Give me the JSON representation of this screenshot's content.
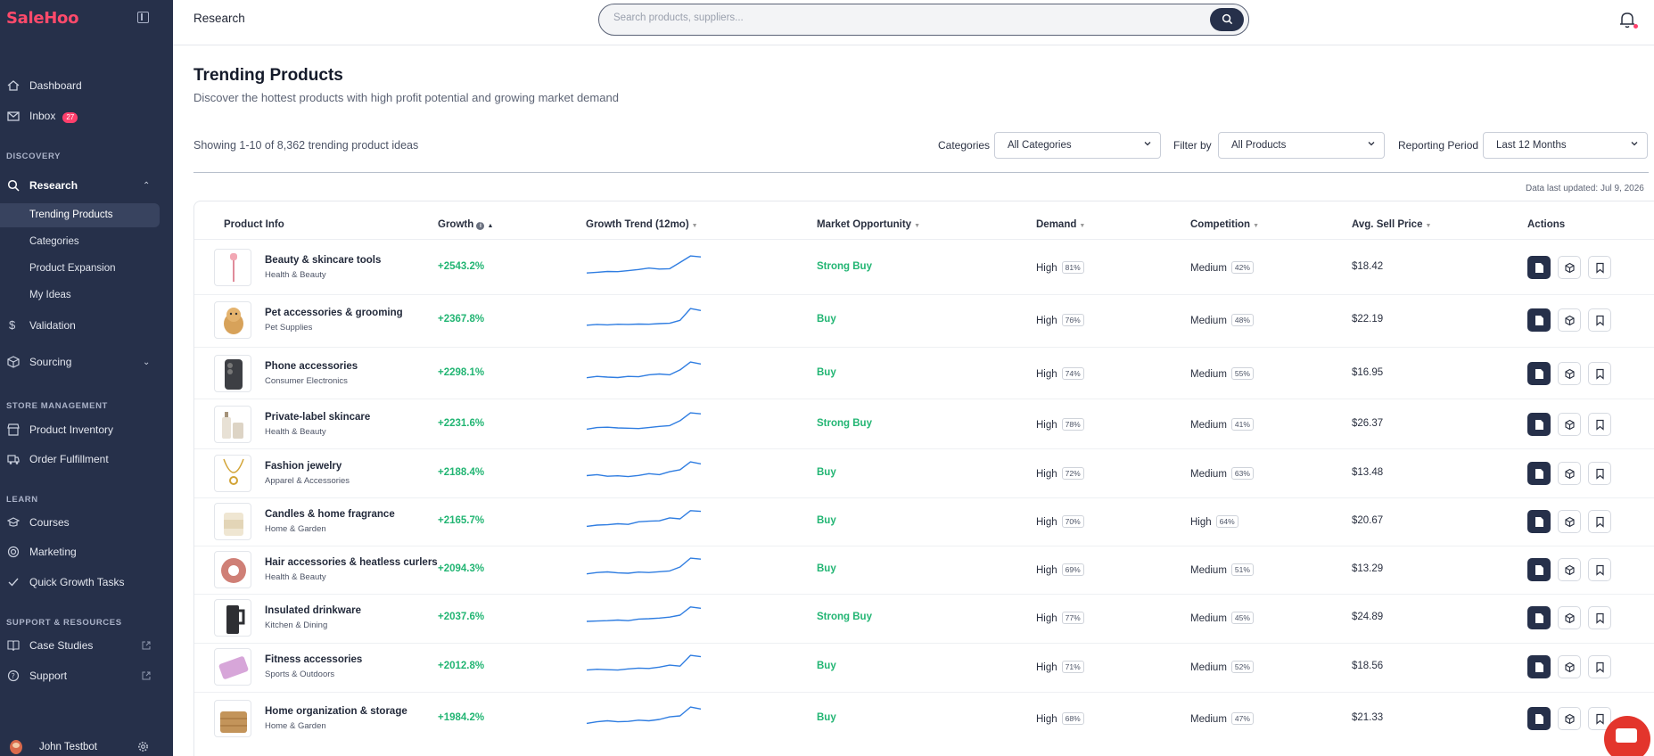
{
  "app": {
    "logo": "SaleHoo",
    "breadcrumb": "Research"
  },
  "search": {
    "placeholder": "Search products, suppliers..."
  },
  "sidebar": {
    "dashboard": "Dashboard",
    "inbox": "Inbox",
    "inbox_count": "27",
    "discovery": "DISCOVERY",
    "research": "Research",
    "research_sub": [
      "Trending Products",
      "Categories",
      "Product Expansion",
      "My Ideas"
    ],
    "validation": "Validation",
    "sourcing": "Sourcing",
    "store_management": "STORE MANAGEMENT",
    "product_inventory": "Product Inventory",
    "order_fulfillment": "Order Fulfillment",
    "learn": "LEARN",
    "courses": "Courses",
    "marketing": "Marketing",
    "quick_growth": "Quick Growth Tasks",
    "support_resources": "SUPPORT & RESOURCES",
    "case_studies": "Case Studies",
    "support": "Support",
    "user_name": "John Testbot"
  },
  "page": {
    "title": "Trending Products",
    "subtitle": "Discover the hottest products with high profit potential and growing market demand",
    "showing": "Showing 1-10 of 8,362 trending product ideas",
    "updated": "Data last updated: Jul 9, 2026"
  },
  "filters": {
    "categories_label": "Categories",
    "categories_value": "All Categories",
    "filter_label": "Filter by",
    "filter_value": "All Products",
    "period_label": "Reporting Period",
    "period_value": "Last 12 Months"
  },
  "columns": [
    "Product Info",
    "Growth",
    "Growth Trend (12mo)",
    "Market Opportunity",
    "Demand",
    "Competition",
    "Avg. Sell Price",
    "Actions"
  ],
  "rows": [
    {
      "name": "Beauty & skincare tools",
      "category": "Health & Beauty",
      "growth": "+2543.2%",
      "opportunity": "Strong Buy",
      "demand": "High",
      "demand_pct": "81%",
      "competition": "Medium",
      "competition_pct": "42%",
      "price": "$18.42",
      "thumb": "roller-icon",
      "trend": [
        0.08,
        0.12,
        0.16,
        0.15,
        0.2,
        0.26,
        0.33,
        0.28,
        0.3,
        0.62,
        0.95,
        0.9
      ]
    },
    {
      "name": "Pet accessories & grooming",
      "category": "Pet Supplies",
      "growth": "+2367.8%",
      "opportunity": "Buy",
      "demand": "High",
      "demand_pct": "76%",
      "competition": "Medium",
      "competition_pct": "48%",
      "price": "$22.19",
      "thumb": "dog-icon",
      "trend": [
        0.1,
        0.14,
        0.12,
        0.15,
        0.14,
        0.16,
        0.15,
        0.18,
        0.2,
        0.35,
        0.95,
        0.85
      ]
    },
    {
      "name": "Phone accessories",
      "category": "Consumer Electronics",
      "growth": "+2298.1%",
      "opportunity": "Buy",
      "demand": "High",
      "demand_pct": "74%",
      "competition": "Medium",
      "competition_pct": "55%",
      "price": "$16.95",
      "thumb": "phone-icon",
      "trend": [
        0.15,
        0.22,
        0.18,
        0.16,
        0.22,
        0.2,
        0.3,
        0.34,
        0.3,
        0.55,
        0.95,
        0.85
      ]
    },
    {
      "name": "Private-label skincare",
      "category": "Health & Beauty",
      "growth": "+2231.6%",
      "opportunity": "Strong Buy",
      "demand": "High",
      "demand_pct": "78%",
      "competition": "Medium",
      "competition_pct": "41%",
      "price": "$26.37",
      "thumb": "bottles-icon",
      "trend": [
        0.12,
        0.2,
        0.22,
        0.18,
        0.17,
        0.15,
        0.2,
        0.26,
        0.3,
        0.55,
        0.95,
        0.9
      ]
    },
    {
      "name": "Fashion jewelry",
      "category": "Apparel & Accessories",
      "growth": "+2188.4%",
      "opportunity": "Buy",
      "demand": "High",
      "demand_pct": "72%",
      "competition": "Medium",
      "competition_pct": "63%",
      "price": "$13.48",
      "thumb": "necklace-icon",
      "trend": [
        0.25,
        0.3,
        0.22,
        0.24,
        0.2,
        0.26,
        0.35,
        0.3,
        0.45,
        0.55,
        0.95,
        0.85
      ]
    },
    {
      "name": "Candles & home fragrance",
      "category": "Home & Garden",
      "growth": "+2165.7%",
      "opportunity": "Buy",
      "demand": "High",
      "demand_pct": "70%",
      "competition": "High",
      "competition_pct": "64%",
      "price": "$20.67",
      "thumb": "candle-icon",
      "trend": [
        0.12,
        0.18,
        0.2,
        0.25,
        0.22,
        0.35,
        0.38,
        0.4,
        0.55,
        0.5,
        0.92,
        0.88
      ]
    },
    {
      "name": "Hair accessories & heatless curlers",
      "category": "Health & Beauty",
      "growth": "+2094.3%",
      "opportunity": "Buy",
      "demand": "High",
      "demand_pct": "69%",
      "competition": "Medium",
      "competition_pct": "51%",
      "price": "$13.29",
      "thumb": "scrunchie-icon",
      "trend": [
        0.15,
        0.22,
        0.25,
        0.2,
        0.18,
        0.24,
        0.22,
        0.26,
        0.3,
        0.5,
        0.95,
        0.9
      ]
    },
    {
      "name": "Insulated drinkware",
      "category": "Kitchen & Dining",
      "growth": "+2037.6%",
      "opportunity": "Strong Buy",
      "demand": "High",
      "demand_pct": "77%",
      "competition": "Medium",
      "competition_pct": "45%",
      "price": "$24.89",
      "thumb": "tumbler-icon",
      "trend": [
        0.18,
        0.2,
        0.22,
        0.25,
        0.22,
        0.3,
        0.32,
        0.35,
        0.4,
        0.5,
        0.92,
        0.85
      ]
    },
    {
      "name": "Fitness accessories",
      "category": "Sports & Outdoors",
      "growth": "+2012.8%",
      "opportunity": "Buy",
      "demand": "High",
      "demand_pct": "71%",
      "competition": "Medium",
      "competition_pct": "52%",
      "price": "$18.56",
      "thumb": "yoga-block-icon",
      "trend": [
        0.2,
        0.24,
        0.22,
        0.2,
        0.26,
        0.3,
        0.28,
        0.35,
        0.45,
        0.4,
        0.95,
        0.88
      ]
    },
    {
      "name": "Home organization & storage",
      "category": "Home & Garden",
      "growth": "+1984.2%",
      "opportunity": "Buy",
      "demand": "High",
      "demand_pct": "68%",
      "competition": "Medium",
      "competition_pct": "47%",
      "price": "$21.33",
      "thumb": "basket-icon",
      "trend": [
        0.12,
        0.2,
        0.25,
        0.2,
        0.22,
        0.28,
        0.25,
        0.32,
        0.45,
        0.5,
        0.95,
        0.85
      ]
    }
  ],
  "colors": {
    "sidebar": "#26304a",
    "accent": "#ff3f6c",
    "positive": "#22b573",
    "spark": "#2f7de1"
  }
}
